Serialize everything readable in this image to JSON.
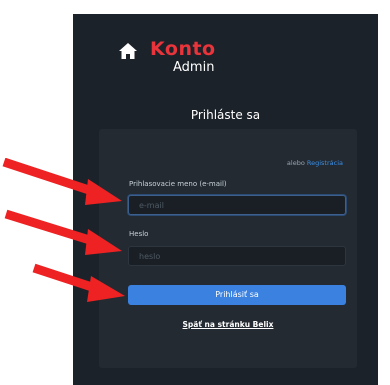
{
  "brand": {
    "name": "Konto",
    "sub": "Admin",
    "name_color": "#e8343a",
    "icon": "home-icon"
  },
  "heading": "Prihláste sa",
  "form": {
    "alt_prefix": "alebo",
    "alt_link": "Registrácia",
    "email_label": "Prihlasovacie meno (e-mail)",
    "email_placeholder": "e-mail",
    "password_label": "Heslo",
    "password_placeholder": "heslo",
    "submit_label": "Prihlásiť sa",
    "back_link": "Späť na stránku Belix"
  },
  "annotations": {
    "arrow_color": "#ee2222",
    "count": 3
  }
}
